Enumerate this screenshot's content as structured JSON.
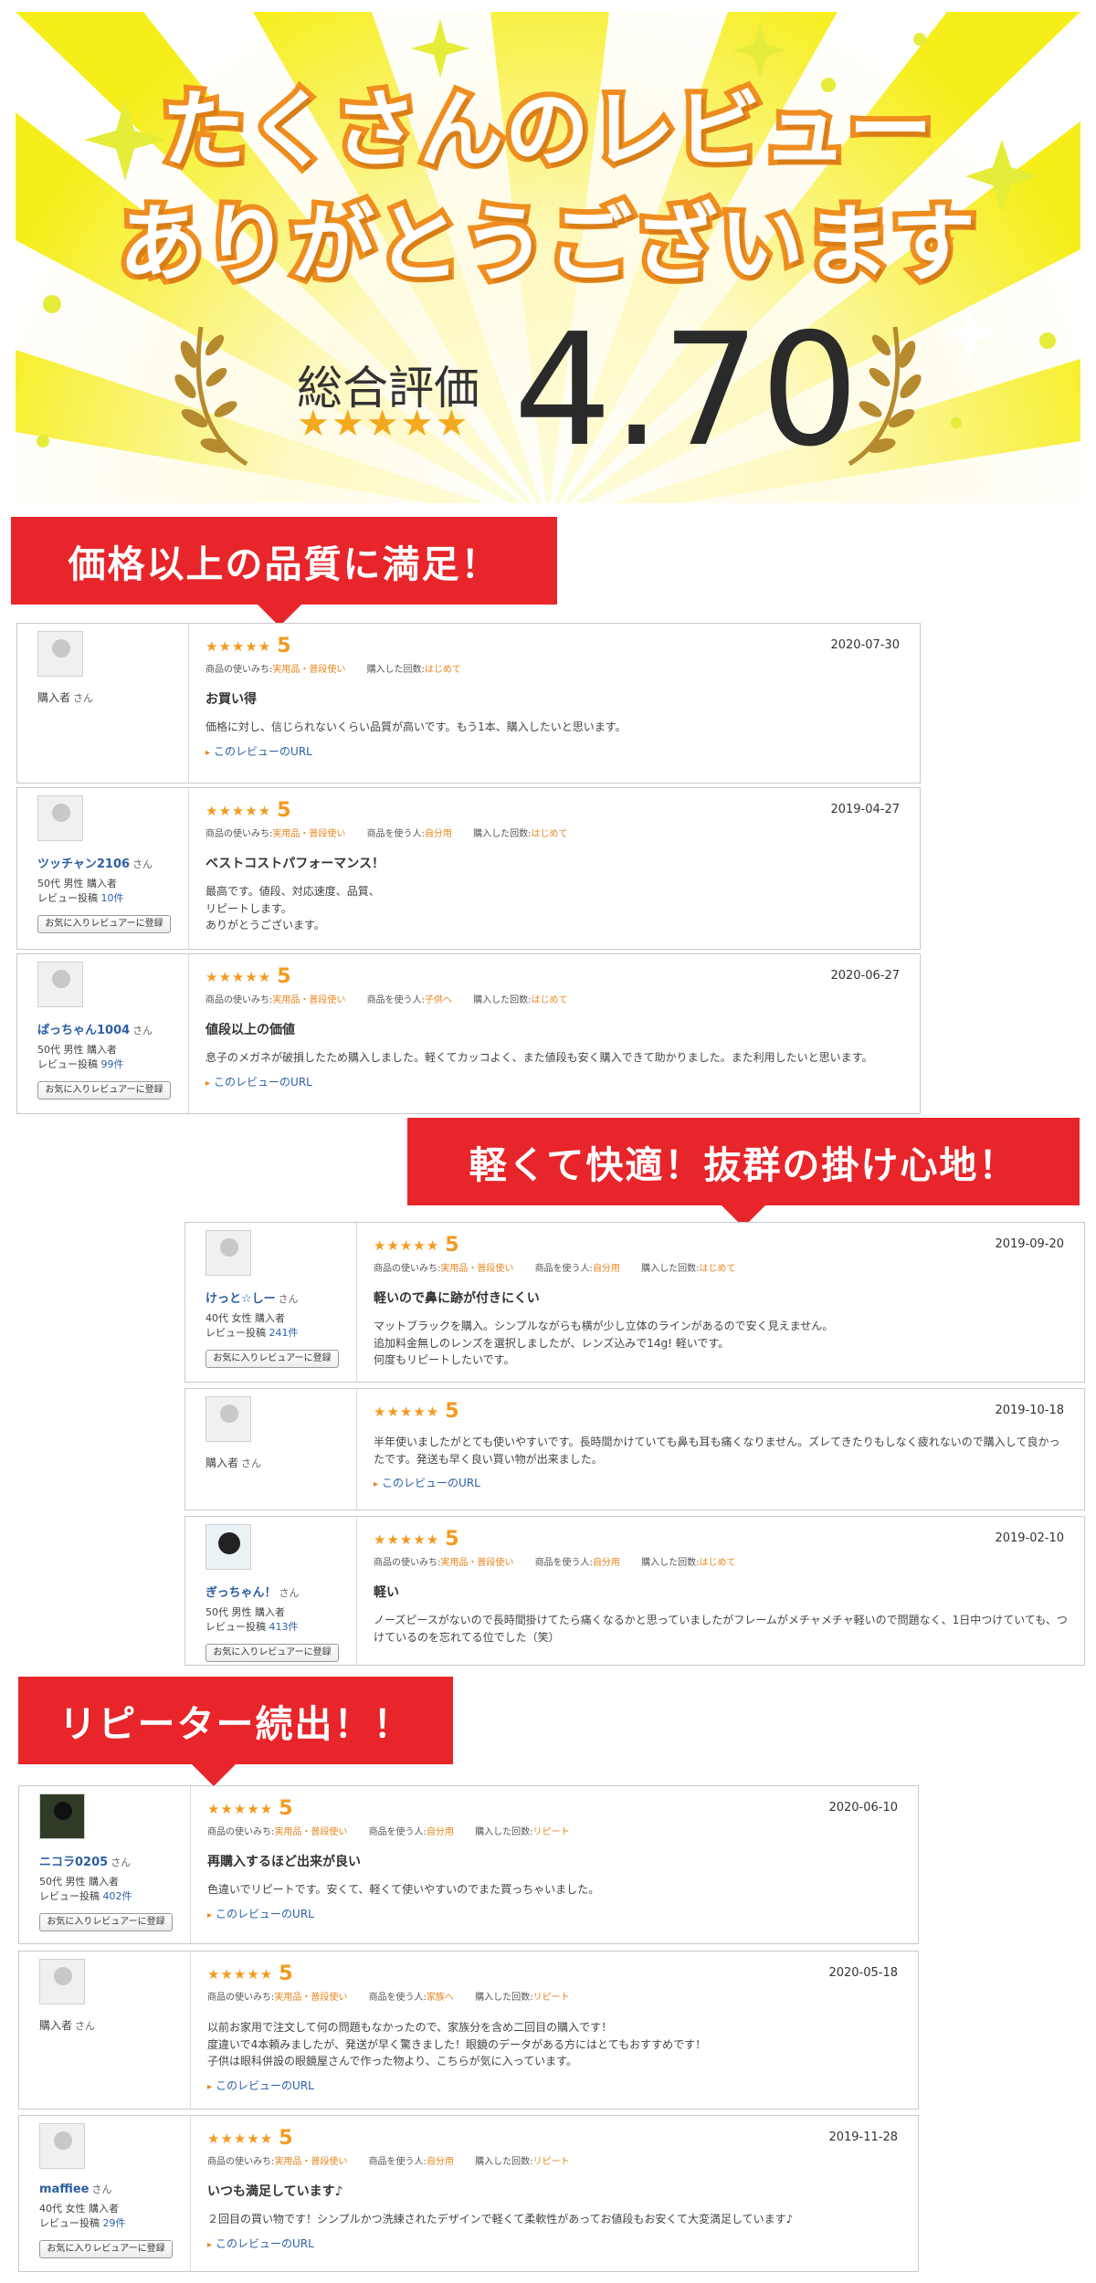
{
  "hero": {
    "title_line1": "たくさんのレビュー",
    "title_line2": "ありがとうございます",
    "score_label": "総合評価",
    "score_stars": "★★★★★",
    "score_value": "4.70",
    "colors": {
      "rays": "#f6ee1a",
      "title_stroke": "#ef8e1f",
      "laurel": "#b68a2e",
      "stars": "#f4a81d"
    }
  },
  "sections": [
    {
      "banner": "価格以上の品質に満足！",
      "reviews": [
        {
          "user": {
            "name": "購入者",
            "suffix": "さん",
            "avatar": "default-avatar",
            "registered": false
          },
          "stars": "★★★★★",
          "score": "5",
          "date": "2020-07-30",
          "tags": [
            {
              "label": "商品の使いみち:",
              "value": "実用品・普段使い"
            },
            {
              "label": "購入した回数:",
              "value": "はじめて"
            }
          ],
          "title": "お買い得",
          "text": "価格に対し、信じられないくらい品質が高いです。もう1本、購入したいと思います。",
          "url_label": "このレビューのURL"
        },
        {
          "user": {
            "name": "ツッチャン2106",
            "suffix": "さん",
            "avatar": "default-avatar",
            "registered": true,
            "profile": "50代 男性 購入者",
            "posts_label": "レビュー投稿",
            "posts": "10件",
            "fav_label": "お気に入りレビュアーに登録"
          },
          "stars": "★★★★★",
          "score": "5",
          "date": "2019-04-27",
          "tags": [
            {
              "label": "商品の使いみち:",
              "value": "実用品・普段使い"
            },
            {
              "label": "商品を使う人:",
              "value": "自分用"
            },
            {
              "label": "購入した回数:",
              "value": "はじめて"
            }
          ],
          "title": "ベストコストパフォーマンス！",
          "text": "最高です。値段、対応速度、品質、\nリピートします。\nありがとうございます。",
          "url_label": ""
        },
        {
          "user": {
            "name": "ぱっちゃん1004",
            "suffix": "さん",
            "avatar": "default-avatar",
            "registered": true,
            "profile": "50代 男性 購入者",
            "posts_label": "レビュー投稿",
            "posts": "99件",
            "fav_label": "お気に入りレビュアーに登録"
          },
          "stars": "★★★★★",
          "score": "5",
          "date": "2020-06-27",
          "tags": [
            {
              "label": "商品の使いみち:",
              "value": "実用品・普段使い"
            },
            {
              "label": "商品を使う人:",
              "value": "子供へ"
            },
            {
              "label": "購入した回数:",
              "value": "はじめて"
            }
          ],
          "title": "値段以上の価値",
          "text": "息子のメガネが破損したため購入しました。軽くてカッコよく、また値段も安く購入できて助かりました。また利用したいと思います。",
          "url_label": "このレビューのURL"
        }
      ]
    },
    {
      "banner": "軽くて快適！抜群の掛け心地！",
      "reviews": [
        {
          "user": {
            "name": "けっと☆しー",
            "suffix": "さん",
            "avatar": "default-avatar",
            "registered": true,
            "profile": "40代 女性 購入者",
            "posts_label": "レビュー投稿",
            "posts": "241件",
            "fav_label": "お気に入りレビュアーに登録"
          },
          "stars": "★★★★★",
          "score": "5",
          "date": "2019-09-20",
          "tags": [
            {
              "label": "商品の使いみち:",
              "value": "実用品・普段使い"
            },
            {
              "label": "商品を使う人:",
              "value": "自分用"
            },
            {
              "label": "購入した回数:",
              "value": "はじめて"
            }
          ],
          "title": "軽いので鼻に跡が付きにくい",
          "text": "マットブラックを購入。シンプルながらも横が少し立体のラインがあるので安く見えません。\n追加料金無しのレンズを選択しましたが、レンズ込みで14g! 軽いです。\n何度もリピートしたいです。",
          "url_label": ""
        },
        {
          "user": {
            "name": "購入者",
            "suffix": "さん",
            "avatar": "default-avatar",
            "registered": false
          },
          "stars": "★★★★★",
          "score": "5",
          "date": "2019-10-18",
          "tags": [],
          "title": "",
          "text": "半年使いましたがとても使いやすいです。長時間かけていても鼻も耳も痛くなりません。ズレてきたりもしなく疲れないので購入して良かったです。発送も早く良い買い物が出来ました。",
          "url_label": "このレビューのURL"
        },
        {
          "user": {
            "name": "ぎっちゃん！",
            "suffix": "さん",
            "avatar": "penguin-avatar",
            "registered": true,
            "profile": "50代 男性 購入者",
            "posts_label": "レビュー投稿",
            "posts": "413件",
            "fav_label": "お気に入りレビュアーに登録"
          },
          "stars": "★★★★★",
          "score": "5",
          "date": "2019-02-10",
          "tags": [
            {
              "label": "商品の使いみち:",
              "value": "実用品・普段使い"
            },
            {
              "label": "商品を使う人:",
              "value": "自分用"
            },
            {
              "label": "購入した回数:",
              "value": "はじめて"
            }
          ],
          "title": "軽い",
          "text": "ノーズピースがないので長時間掛けてたら痛くなるかと思っていましたがフレームがメチャメチャ軽いので問題なく、1日中つけていても、つけているのを忘れてる位でした（笑）",
          "url_label": ""
        }
      ]
    },
    {
      "banner": "リピーター続出！！",
      "reviews": [
        {
          "user": {
            "name": "ニコラ0205",
            "suffix": "さん",
            "avatar": "cat-avatar",
            "registered": true,
            "profile": "50代 男性 購入者",
            "posts_label": "レビュー投稿",
            "posts": "402件",
            "fav_label": "お気に入りレビュアーに登録"
          },
          "stars": "★★★★★",
          "score": "5",
          "date": "2020-06-10",
          "tags": [
            {
              "label": "商品の使いみち:",
              "value": "実用品・普段使い"
            },
            {
              "label": "商品を使う人:",
              "value": "自分用"
            },
            {
              "label": "購入した回数:",
              "value": "リピート"
            }
          ],
          "title": "再購入するほど出来が良い",
          "text": "色違いでリピートです。安くて、軽くて使いやすいのでまた買っちゃいました。",
          "url_label": "このレビューのURL"
        },
        {
          "user": {
            "name": "購入者",
            "suffix": "さん",
            "avatar": "default-avatar",
            "registered": false
          },
          "stars": "★★★★★",
          "score": "5",
          "date": "2020-05-18",
          "tags": [
            {
              "label": "商品の使いみち:",
              "value": "実用品・普段使い"
            },
            {
              "label": "商品を使う人:",
              "value": "家族へ"
            },
            {
              "label": "購入した回数:",
              "value": "リピート"
            }
          ],
          "title": "",
          "text": "以前お家用で注文して何の問題もなかったので、家族分を含め二回目の購入です！\n度違いで4本頼みましたが、発送が早く驚きました！眼鏡のデータがある方にはとてもおすすめです！\n子供は眼科併設の眼鏡屋さんで作った物より、こちらが気に入っています。",
          "url_label": "このレビューのURL"
        },
        {
          "user": {
            "name": "maffiee",
            "suffix": "さん",
            "avatar": "default-avatar",
            "registered": true,
            "profile": "40代 女性 購入者",
            "posts_label": "レビュー投稿",
            "posts": "29件",
            "fav_label": "お気に入りレビュアーに登録"
          },
          "stars": "★★★★★",
          "score": "5",
          "date": "2019-11-28",
          "tags": [
            {
              "label": "商品の使いみち:",
              "value": "実用品・普段使い"
            },
            {
              "label": "商品を使う人:",
              "value": "自分用"
            },
            {
              "label": "購入した回数:",
              "value": "リピート"
            }
          ],
          "title": "いつも満足しています♪",
          "text": "２回目の買い物です！シンプルかつ洗練されたデザインで軽くて柔軟性があってお値段もお安くて大変満足しています♪",
          "url_label": "このレビューのURL"
        }
      ]
    }
  ]
}
